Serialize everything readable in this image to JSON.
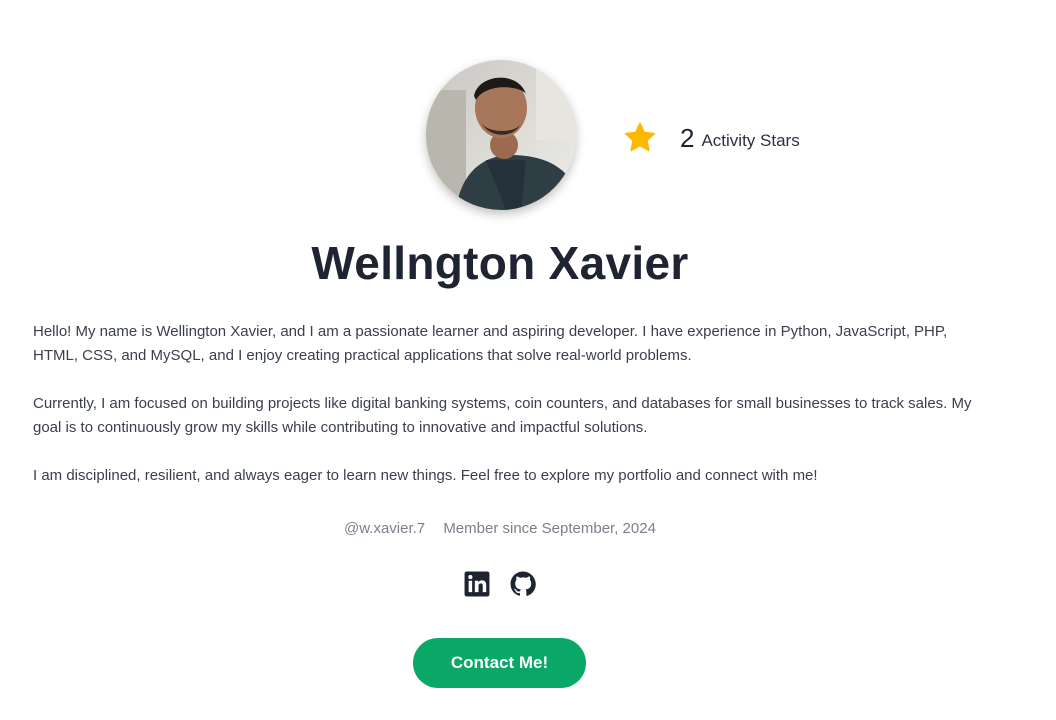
{
  "profile": {
    "name": "Wellngton Xavier",
    "avatar_alt": "Profile photo",
    "activity": {
      "count": "2",
      "label": "Activity Stars",
      "star_color": "#ffb800"
    },
    "bio": [
      "Hello! My name is Wellington Xavier, and I am a passionate learner and aspiring developer. I have experience in Python, JavaScript, PHP, HTML, CSS, and MySQL, and I enjoy creating practical applications that solve real-world problems.",
      "Currently, I am focused on building projects like digital banking systems, coin counters, and databases for small businesses to track sales. My goal is to continuously grow my skills while contributing to innovative and impactful solutions.",
      "I am disciplined, resilient, and always eager to learn new things. Feel free to explore my portfolio and connect with me!"
    ],
    "handle": "@w.xavier.7",
    "member_since": "Member since September, 2024"
  },
  "socials": [
    {
      "name": "LinkedIn",
      "icon": "linkedin-icon"
    },
    {
      "name": "GitHub",
      "icon": "github-icon"
    }
  ],
  "contact_button": {
    "label": "Contact Me!",
    "color": "#0aa866"
  }
}
